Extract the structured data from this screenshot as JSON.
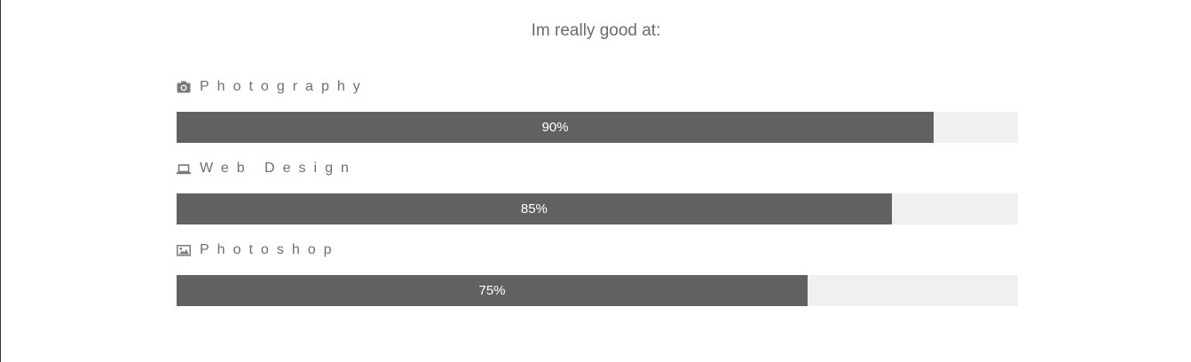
{
  "heading": "Im really good at:",
  "colors": {
    "bar_fill": "#616161",
    "bar_track": "#f0f0f0",
    "label_text": "#6e6e6e",
    "bar_text": "#ffffff"
  },
  "skills": [
    {
      "label": "Photography",
      "icon": "camera-icon",
      "percent_label": "90%",
      "level": 90
    },
    {
      "label": "Web Design",
      "icon": "laptop-icon",
      "percent_label": "85%",
      "level": 85
    },
    {
      "label": "Photoshop",
      "icon": "image-icon",
      "percent_label": "75%",
      "level": 75
    }
  ]
}
